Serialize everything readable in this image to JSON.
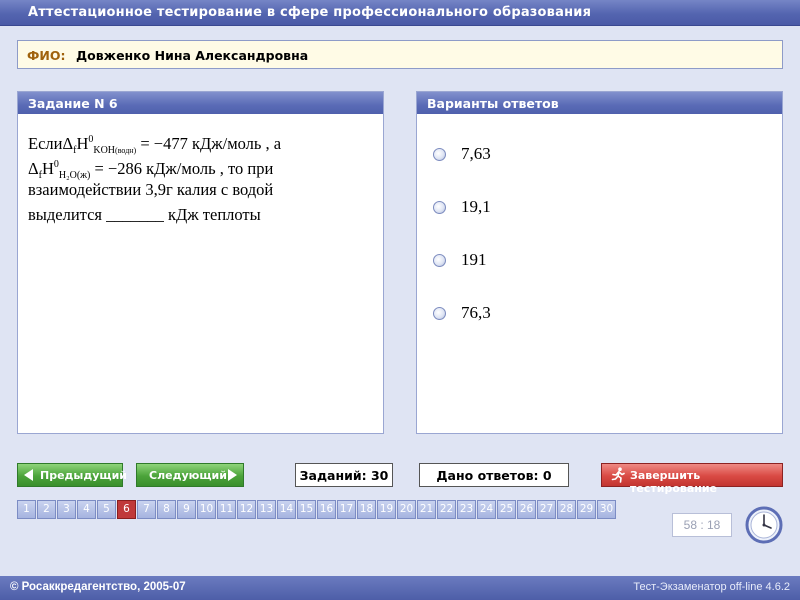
{
  "window": {
    "title": "Аттестационное тестирование в сфере профессионального образования"
  },
  "fio": {
    "label": "ФИО:",
    "value": "Довженко Нина Александровна"
  },
  "task_panel": {
    "title": "Задание N 6",
    "question": {
      "line1_prefix": "Если",
      "line1_delta": "Δ",
      "line1_f": "f",
      "line1_H": "H",
      "line1_sup": "0",
      "line1_sub": "KOH",
      "line1_sub_small": "(водн)",
      "line1_rest": " = −477 кДж/моль , а",
      "line2_delta": "Δ",
      "line2_f": "f",
      "line2_H": "H",
      "line2_sup": "0",
      "line2_sub": "H₂O(ж)",
      "line2_rest": " = −286 кДж/моль , то при",
      "line3": "взаимодействии 3,9г калия с водой",
      "line4": "выделится _______ кДж теплоты"
    }
  },
  "answers_panel": {
    "title": "Варианты ответов",
    "options": [
      "7,63",
      "19,1",
      "191",
      "76,3"
    ]
  },
  "nav": {
    "prev_label": "Предыдущий",
    "next_label": "Следующий",
    "tasks_count": "Заданий: 30",
    "answered_count": "Дано ответов: 0",
    "finish_label": "Завершить тестирование"
  },
  "question_numbers": {
    "items": [
      "1",
      "2",
      "3",
      "4",
      "5",
      "6",
      "7",
      "8",
      "9",
      "10",
      "11",
      "12",
      "13",
      "14",
      "15",
      "16",
      "17",
      "18",
      "19",
      "20",
      "21",
      "22",
      "23",
      "24",
      "25",
      "26",
      "27",
      "28",
      "29",
      "30"
    ],
    "current": "6"
  },
  "timer": {
    "value": "58 : 18"
  },
  "footer": {
    "copyright": "© Росаккредагентство, 2005-07",
    "version": "Тест-Экзаменатор off-line 4.6.2"
  },
  "colors": {
    "title_bar": "#5465b0",
    "panel_header": "#5a6bb6",
    "fio_label": "#a0620c",
    "nav_button": "#4ba33a",
    "finish_button": "#d94a44",
    "current_question": "#c0393a",
    "question_chip": "#a6b4e0"
  },
  "icons": {
    "prev": "arrow-left-icon",
    "next": "arrow-right-icon",
    "finish": "running-man-icon",
    "clock": "clock-icon",
    "radio": "radio-unchecked-icon"
  }
}
